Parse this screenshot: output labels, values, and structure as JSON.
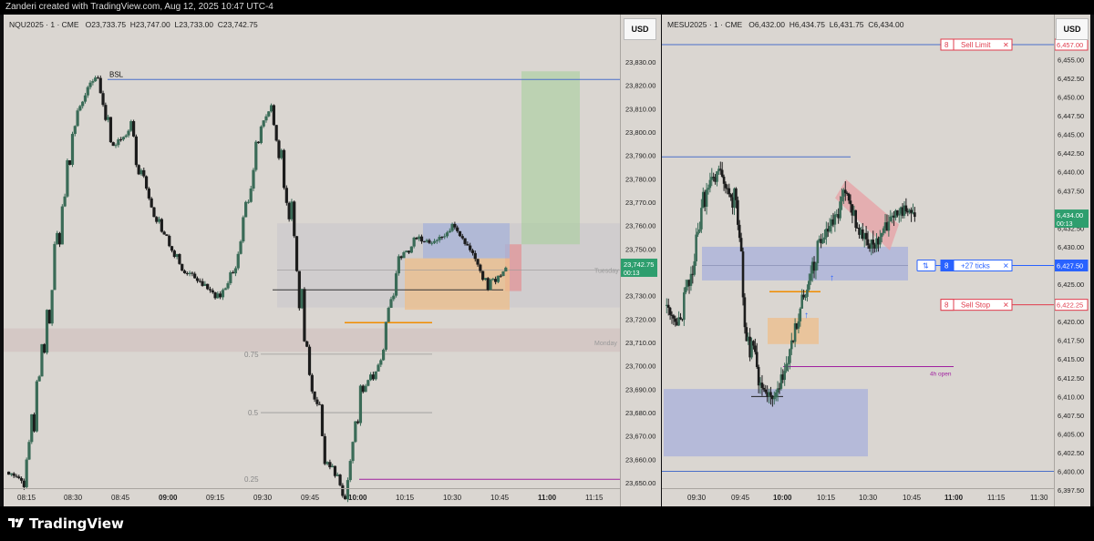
{
  "header": {
    "text": "Zanderi created with TradingView.com, Aug 12, 2025 10:47 UTC-4"
  },
  "footer": {
    "brand": "TradingView"
  },
  "colors": {
    "bg": "#dad6d1",
    "candle_up": "#3a6b57",
    "candle_down": "#1c1c1c",
    "blue_line": "#4a6fc9",
    "purple_line": "#a020a0",
    "orange_line": "#f08c00",
    "price_tag_green": "#2e9e6e",
    "price_tag_blue": "#2962ff",
    "order_red": "#e03c4d"
  },
  "left": {
    "symbol": "NQU2025 · 1 · CME",
    "open": "O23,733.75",
    "high": "H23,747.00",
    "low": "L23,733.00",
    "close": "C23,742.75",
    "currency": "USD",
    "y_ticks": [
      "23,830.00",
      "23,820.00",
      "23,810.00",
      "23,800.00",
      "23,790.00",
      "23,780.00",
      "23,770.00",
      "23,760.00",
      "23,750.00",
      "23,730.00",
      "23,720.00",
      "23,710.00",
      "23,700.00",
      "23,690.00",
      "23,680.00",
      "23,670.00",
      "23,660.00",
      "23,650.00"
    ],
    "x_ticks": [
      "08:15",
      "08:30",
      "08:45",
      "09:00",
      "09:15",
      "09:30",
      "09:45",
      "10:00",
      "10:15",
      "10:30",
      "10:45",
      "11:00",
      "11:15"
    ],
    "bold_ticks": [
      "09:00",
      "10:00",
      "11:00"
    ],
    "price_tag": {
      "value": "23,742.75",
      "timer": "00:13"
    },
    "labels": {
      "bsl": "BSL",
      "tuesday": "Tuesday",
      "monday": "Monday",
      "fib_075": "0.75",
      "fib_05": "0.5",
      "fib_025": "0.25"
    },
    "icons": [
      "tradingview-logo-icon"
    ]
  },
  "right": {
    "symbol": "MESU2025 · 1 · CME",
    "open": "O6,432.00",
    "high": "H6,434.75",
    "low": "L6,431.75",
    "close": "C6,434.00",
    "currency": "USD",
    "y_ticks": [
      "6,455.00",
      "6,452.50",
      "6,450.00",
      "6,447.50",
      "6,445.00",
      "6,442.50",
      "6,440.00",
      "6,437.50",
      "6,432.50",
      "6,430.00",
      "6,425.00",
      "6,420.00",
      "6,417.50",
      "6,415.00",
      "6,412.50",
      "6,410.00",
      "6,407.50",
      "6,405.00",
      "6,402.50",
      "6,400.00",
      "6,397.50"
    ],
    "x_ticks": [
      "09:30",
      "09:45",
      "10:00",
      "10:15",
      "10:30",
      "10:45",
      "11:00",
      "11:15",
      "11:30"
    ],
    "bold_ticks": [
      "10:00",
      "11:00"
    ],
    "price_tag": {
      "value": "6,434.00",
      "timer": "00:13"
    },
    "order_tags": {
      "sell_limit": "6,457.00",
      "position": "6,427.50",
      "sell_stop": "6,422.25"
    },
    "orders": {
      "sell_limit": {
        "qty": "8",
        "label": "Sell Limit",
        "close": "✕"
      },
      "position": {
        "icon": "⇅",
        "qty": "8",
        "label": "+27 ticks",
        "close": "✕"
      },
      "sell_stop": {
        "qty": "8",
        "label": "Sell Stop",
        "close": "✕"
      }
    },
    "labels": {
      "four_h_open": "4h open"
    }
  }
}
